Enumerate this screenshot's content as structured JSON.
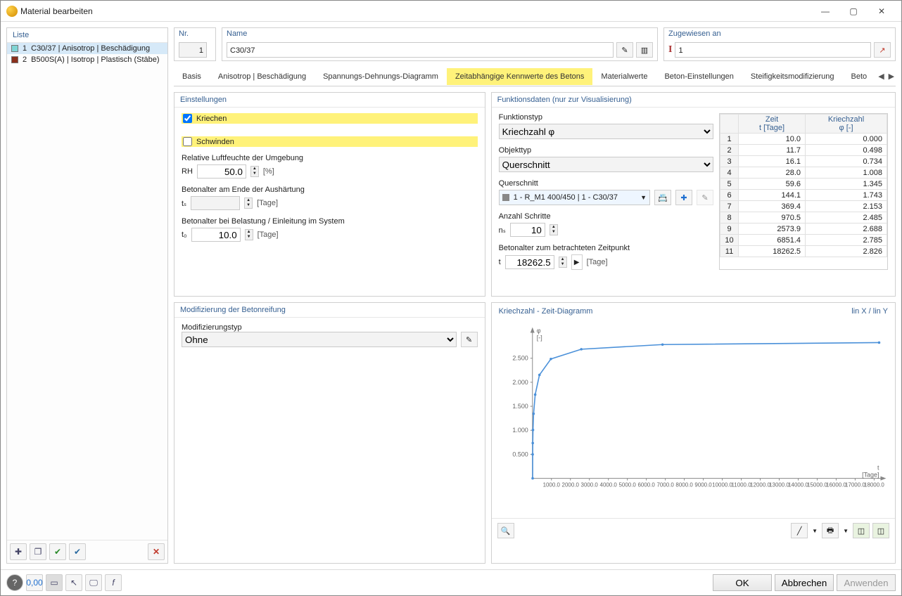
{
  "window": {
    "title": "Material bearbeiten"
  },
  "list": {
    "header": "Liste",
    "items": [
      {
        "num": "1",
        "label": "C30/37 | Anisotrop | Beschädigung"
      },
      {
        "num": "2",
        "label": "B500S(A) | Isotrop | Plastisch (Stäbe)"
      }
    ]
  },
  "header": {
    "nr_label": "Nr.",
    "nr_value": "1",
    "name_label": "Name",
    "name_value": "C30/37",
    "assign_label": "Zugewiesen an",
    "assign_value": "1"
  },
  "tabs": [
    "Basis",
    "Anisotrop | Beschädigung",
    "Spannungs-Dehnungs-Diagramm",
    "Zeitabhängige Kennwerte des Betons",
    "Materialwerte",
    "Beton-Einstellungen",
    "Steifigkeitsmodifizierung",
    "Beto"
  ],
  "active_tab": 3,
  "settings": {
    "title": "Einstellungen",
    "cb_kriechen": "Kriechen",
    "cb_schwinden": "Schwinden",
    "rh_label": "Relative Luftfeuchte der Umgebung",
    "rh_sym": "RH",
    "rh_val": "50.0",
    "rh_unit": "[%]",
    "ts_label": "Betonalter am Ende der Aushärtung",
    "ts_sym": "tₛ",
    "ts_val": "",
    "ts_unit": "[Tage]",
    "t0_label": "Betonalter bei Belastung / Einleitung im System",
    "t0_sym": "t₀",
    "t0_val": "10.0",
    "t0_unit": "[Tage]"
  },
  "funcdata": {
    "title": "Funktionsdaten (nur zur Visualisierung)",
    "ftype_label": "Funktionstyp",
    "ftype_value": "Kriechzahl φ",
    "otype_label": "Objekttyp",
    "otype_value": "Querschnitt",
    "cs_label": "Querschnitt",
    "cs_value": "1 - R_M1 400/450 | 1 - C30/37",
    "ns_label": "Anzahl Schritte",
    "ns_sym": "nₛ",
    "ns_val": "10",
    "t_label": "Betonalter zum betrachteten Zeitpunkt",
    "t_sym": "t",
    "t_val": "18262.5",
    "t_unit": "[Tage]"
  },
  "table": {
    "col1": "Zeit",
    "col1u": "t [Tage]",
    "col2": "Kriechzahl",
    "col2u": "φ [-]",
    "rows": [
      [
        "1",
        "10.0",
        "0.000"
      ],
      [
        "2",
        "11.7",
        "0.498"
      ],
      [
        "3",
        "16.1",
        "0.734"
      ],
      [
        "4",
        "28.0",
        "1.008"
      ],
      [
        "5",
        "59.6",
        "1.345"
      ],
      [
        "6",
        "144.1",
        "1.743"
      ],
      [
        "7",
        "369.4",
        "2.153"
      ],
      [
        "8",
        "970.5",
        "2.485"
      ],
      [
        "9",
        "2573.9",
        "2.688"
      ],
      [
        "10",
        "6851.4",
        "2.785"
      ],
      [
        "11",
        "18262.5",
        "2.826"
      ]
    ]
  },
  "mod": {
    "title": "Modifizierung der Betonreifung",
    "mtype_label": "Modifizierungstyp",
    "mtype_value": "Ohne"
  },
  "chart": {
    "title": "Kriechzahl - Zeit-Diagramm",
    "mode": "lin X / lin Y",
    "ylab_sym": "φ",
    "ylab_unit": "[-]",
    "xlab_sym": "t",
    "xlab_unit": "[Tage]",
    "yticks": [
      "0.500",
      "1.000",
      "1.500",
      "2.000",
      "2.500"
    ],
    "xticks": [
      "1000.0",
      "2000.0",
      "3000.0",
      "4000.0",
      "5000.0",
      "6000.0",
      "7000.0",
      "8000.0",
      "9000.0",
      "10000.0",
      "11000.0",
      "12000.0",
      "13000.0",
      "14000.0",
      "15000.0",
      "16000.0",
      "17000.0",
      "18000.0"
    ]
  },
  "chart_data": {
    "type": "line",
    "title": "Kriechzahl - Zeit-Diagramm",
    "xlabel": "t [Tage]",
    "ylabel": "φ [-]",
    "xlim": [
      0,
      18262.5
    ],
    "ylim": [
      0,
      3.0
    ],
    "x": [
      10.0,
      11.7,
      16.1,
      28.0,
      59.6,
      144.1,
      369.4,
      970.5,
      2573.9,
      6851.4,
      18262.5
    ],
    "y": [
      0.0,
      0.498,
      0.734,
      1.008,
      1.345,
      1.743,
      2.153,
      2.485,
      2.688,
      2.785,
      2.826
    ]
  },
  "footer": {
    "ok": "OK",
    "cancel": "Abbrechen",
    "apply": "Anwenden"
  }
}
